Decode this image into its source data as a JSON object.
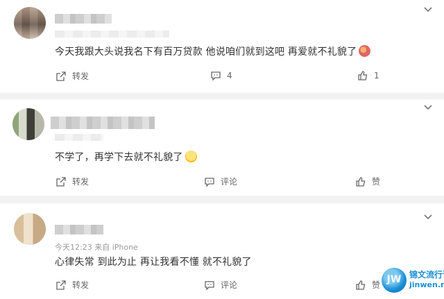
{
  "comments": [
    {
      "text": "今天我跟大头说我名下有百万贷款 他说咱们就到这吧 再爱就不礼貌了",
      "emoji_icon": "red-face-emoji-icon",
      "actions": {
        "share": "转发",
        "comment": "4",
        "like": "1"
      }
    },
    {
      "text": "不学了，再学下去就不礼貌了",
      "emoji_icon": "smile-emoji-icon",
      "actions": {
        "share": "转发",
        "comment": "评论",
        "like": "赞"
      }
    },
    {
      "meta": "今天12:23 来自 iPhone",
      "text": "心律失常 到此为止 再让我看不懂 就不礼貌了",
      "actions": {
        "share": "转发",
        "comment": "评论",
        "like": "赞"
      }
    }
  ],
  "watermark": {
    "logo": "JW",
    "line1": "锦文流行语",
    "line2": "jinwen.net"
  },
  "icons": {
    "more": "chevron-down-icon",
    "share": "share-icon",
    "comment": "comment-icon",
    "like": "thumbs-up-icon"
  },
  "colors": {
    "background": "#f2f2f2",
    "card": "#ffffff",
    "text": "#333333",
    "muted": "#666666",
    "watermark": "#1a8fd6"
  }
}
